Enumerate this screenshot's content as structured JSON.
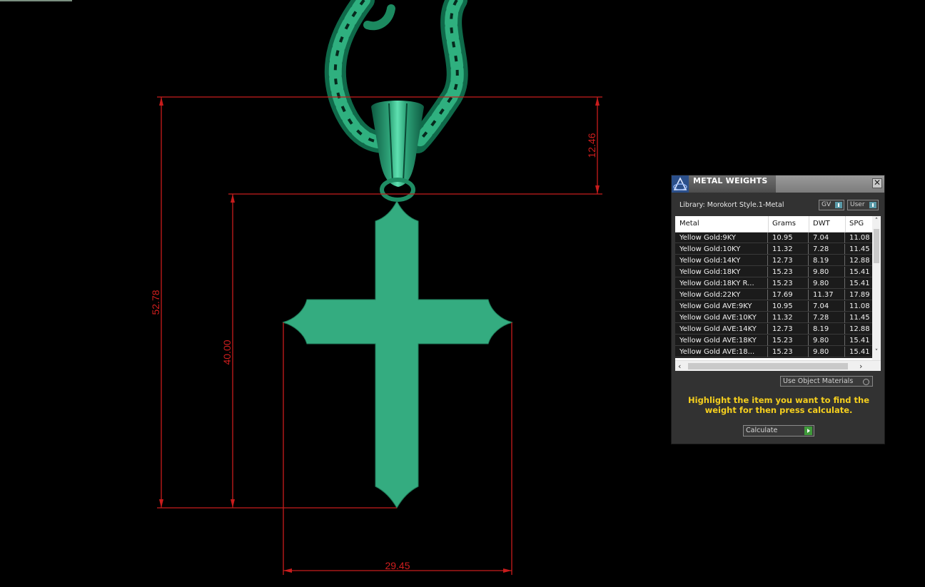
{
  "viewport": {
    "background": "#000000",
    "model_color": "#34ac80",
    "dimension_color": "#d11e1e",
    "dimensions": {
      "bail_height": "12.46",
      "total_height": "52.78",
      "cross_height": "40.00",
      "cross_width": "29.45"
    }
  },
  "panel": {
    "title": "METAL WEIGHTS",
    "close_label": "✕",
    "library_label": "Library: Morokort Style.1-Metal",
    "gv_toggle": "GV",
    "user_toggle": "User",
    "columns": [
      "Metal",
      "Grams",
      "DWT",
      "SPG"
    ],
    "rows": [
      [
        "Yellow Gold:9KY",
        "10.95",
        "7.04",
        "11.08"
      ],
      [
        "Yellow Gold:10KY",
        "11.32",
        "7.28",
        "11.45"
      ],
      [
        "Yellow Gold:14KY",
        "12.73",
        "8.19",
        "12.88"
      ],
      [
        "Yellow Gold:18KY",
        "15.23",
        "9.80",
        "15.41"
      ],
      [
        "Yellow Gold:18KY R...",
        "15.23",
        "9.80",
        "15.41"
      ],
      [
        "Yellow Gold:22KY",
        "17.69",
        "11.37",
        "17.89"
      ],
      [
        "Yellow Gold AVE:9KY",
        "10.95",
        "7.04",
        "11.08"
      ],
      [
        "Yellow Gold AVE:10KY",
        "11.32",
        "7.28",
        "11.45"
      ],
      [
        "Yellow Gold AVE:14KY",
        "12.73",
        "8.19",
        "12.88"
      ],
      [
        "Yellow Gold AVE:18KY",
        "15.23",
        "9.80",
        "15.41"
      ],
      [
        "Yellow Gold AVE:18...",
        "15.23",
        "9.80",
        "15.41"
      ]
    ],
    "use_object_materials": "Use Object Materials",
    "hint": "Highlight the item you want to find the weight for then press calculate.",
    "calculate_label": "Calculate"
  }
}
